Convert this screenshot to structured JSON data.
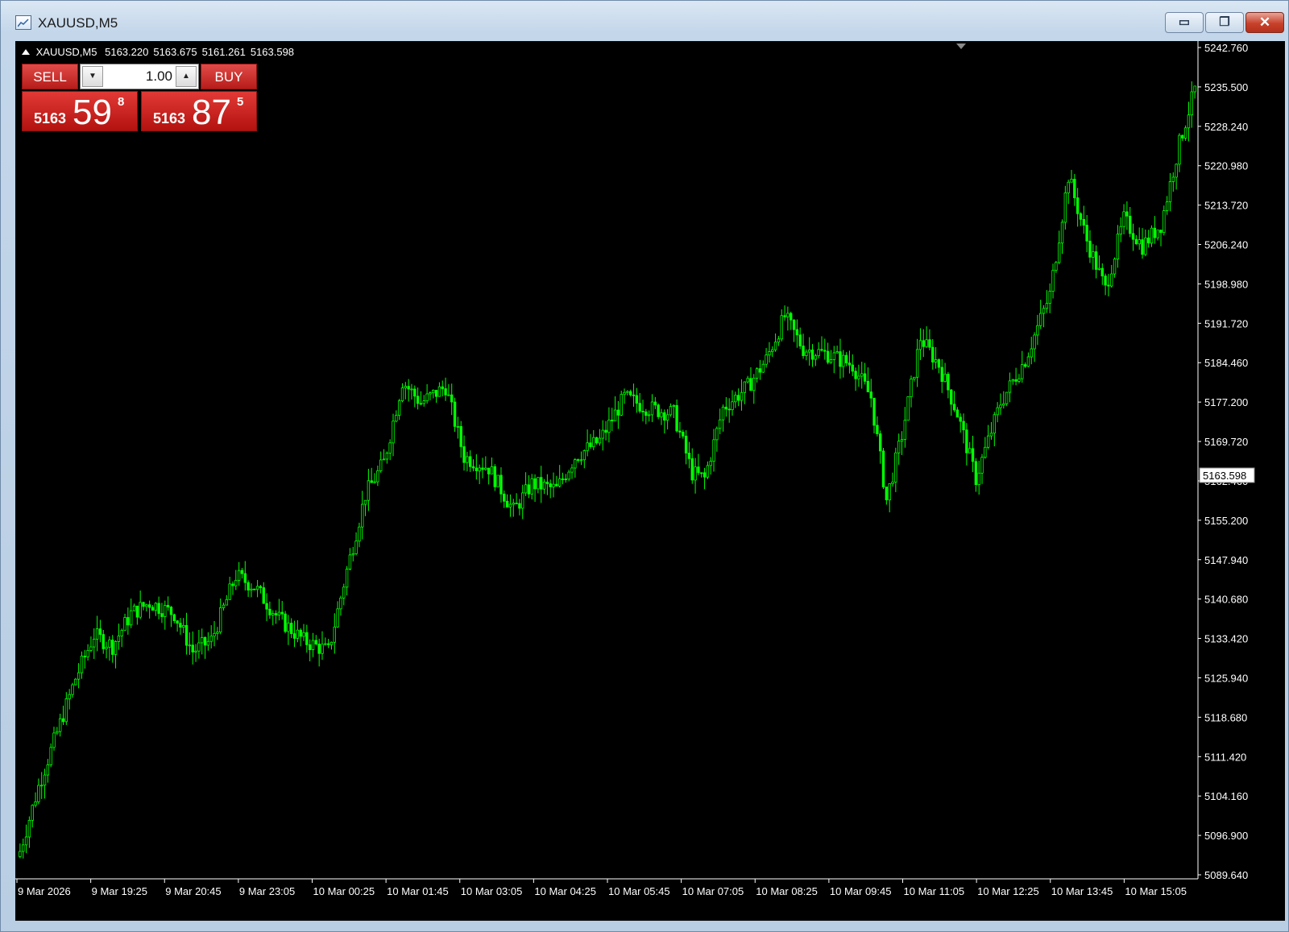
{
  "window": {
    "title": "XAUUSD,M5",
    "controls": {
      "minimize": "▭",
      "maximize": "❐",
      "close": "✕"
    }
  },
  "quote": {
    "symbol": "XAUUSD,M5",
    "open": "5163.220",
    "high": "5163.675",
    "low": "5161.261",
    "close": "5163.598"
  },
  "one_click": {
    "sell_label": "SELL",
    "buy_label": "BUY",
    "lot": "1.00",
    "sell_prefix": "5163",
    "sell_big": "59",
    "sell_sup": "8",
    "buy_prefix": "5163",
    "buy_big": "87",
    "buy_sup": "5"
  },
  "colors": {
    "background": "#000000",
    "candle": "#00ff00",
    "price_tag_bg": "#ffffff",
    "sell_buy": "#c8201c"
  },
  "chart_data": {
    "type": "candlestick",
    "symbol": "XAUUSD",
    "timeframe": "M5",
    "current_price": "5163.598",
    "ylim": [
      5089.64,
      5242.76
    ],
    "y_ticks": [
      "5242.760",
      "5235.500",
      "5228.240",
      "5220.980",
      "5213.720",
      "5206.240",
      "5198.980",
      "5191.720",
      "5184.460",
      "5177.200",
      "5169.720",
      "5162.460",
      "5155.200",
      "5147.940",
      "5140.680",
      "5133.420",
      "5125.940",
      "5118.680",
      "5111.420",
      "5104.160",
      "5096.900",
      "5089.640"
    ],
    "x_ticks": [
      "9 Mar 2026",
      "9 Mar 19:25",
      "9 Mar 20:45",
      "9 Mar 23:05",
      "10 Mar 00:25",
      "10 Mar 01:45",
      "10 Mar 03:05",
      "10 Mar 04:25",
      "10 Mar 05:45",
      "10 Mar 07:05",
      "10 Mar 08:25",
      "10 Mar 09:45",
      "10 Mar 11:05",
      "10 Mar 12:25",
      "10 Mar 13:45",
      "10 Mar 15:05"
    ],
    "grid": false,
    "close_path": [
      {
        "bar": 0,
        "price": 5094.0
      },
      {
        "bar": 6,
        "price": 5106.0
      },
      {
        "bar": 12,
        "price": 5116.0
      },
      {
        "bar": 18,
        "price": 5126.0
      },
      {
        "bar": 24,
        "price": 5134.0
      },
      {
        "bar": 30,
        "price": 5132.0
      },
      {
        "bar": 36,
        "price": 5138.0
      },
      {
        "bar": 42,
        "price": 5140.0
      },
      {
        "bar": 50,
        "price": 5138.0
      },
      {
        "bar": 56,
        "price": 5131.0
      },
      {
        "bar": 62,
        "price": 5133.0
      },
      {
        "bar": 70,
        "price": 5145.0
      },
      {
        "bar": 76,
        "price": 5143.0
      },
      {
        "bar": 84,
        "price": 5137.0
      },
      {
        "bar": 92,
        "price": 5133.0
      },
      {
        "bar": 100,
        "price": 5131.0
      },
      {
        "bar": 106,
        "price": 5146.0
      },
      {
        "bar": 112,
        "price": 5160.0
      },
      {
        "bar": 118,
        "price": 5166.0
      },
      {
        "bar": 124,
        "price": 5181.0
      },
      {
        "bar": 130,
        "price": 5177.0
      },
      {
        "bar": 138,
        "price": 5180.0
      },
      {
        "bar": 144,
        "price": 5167.0
      },
      {
        "bar": 152,
        "price": 5165.0
      },
      {
        "bar": 160,
        "price": 5157.0
      },
      {
        "bar": 166,
        "price": 5162.0
      },
      {
        "bar": 174,
        "price": 5161.0
      },
      {
        "bar": 180,
        "price": 5167.0
      },
      {
        "bar": 188,
        "price": 5170.0
      },
      {
        "bar": 196,
        "price": 5178.0
      },
      {
        "bar": 204,
        "price": 5176.0
      },
      {
        "bar": 212,
        "price": 5175.0
      },
      {
        "bar": 218,
        "price": 5164.0
      },
      {
        "bar": 222,
        "price": 5163.0
      },
      {
        "bar": 228,
        "price": 5176.0
      },
      {
        "bar": 236,
        "price": 5180.0
      },
      {
        "bar": 242,
        "price": 5185.0
      },
      {
        "bar": 248,
        "price": 5193.0
      },
      {
        "bar": 254,
        "price": 5187.0
      },
      {
        "bar": 262,
        "price": 5186.0
      },
      {
        "bar": 270,
        "price": 5184.0
      },
      {
        "bar": 276,
        "price": 5178.0
      },
      {
        "bar": 281,
        "price": 5159.0
      },
      {
        "bar": 286,
        "price": 5171.0
      },
      {
        "bar": 292,
        "price": 5189.0
      },
      {
        "bar": 298,
        "price": 5184.0
      },
      {
        "bar": 304,
        "price": 5175.0
      },
      {
        "bar": 310,
        "price": 5163.0
      },
      {
        "bar": 318,
        "price": 5177.0
      },
      {
        "bar": 326,
        "price": 5185.0
      },
      {
        "bar": 334,
        "price": 5197.0
      },
      {
        "bar": 340,
        "price": 5219.0
      },
      {
        "bar": 346,
        "price": 5207.0
      },
      {
        "bar": 352,
        "price": 5198.0
      },
      {
        "bar": 358,
        "price": 5211.0
      },
      {
        "bar": 364,
        "price": 5206.0
      },
      {
        "bar": 370,
        "price": 5210.0
      },
      {
        "bar": 376,
        "price": 5225.0
      },
      {
        "bar": 381,
        "price": 5235.0
      }
    ]
  }
}
